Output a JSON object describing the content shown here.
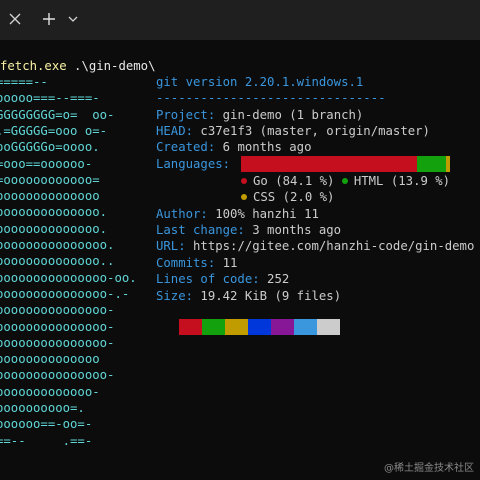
{
  "tabbar": {
    "icons": [
      "close-icon",
      "plus-icon",
      "chevron-down-icon"
    ]
  },
  "command": {
    "exe": "fetch.exe",
    "arg": " .\\gin-demo\\"
  },
  "logo": {
    "lines": [
      "=====--",
      "ooooo===--===-",
      "GGGGGGGG=o=  oo-",
      ".=GGGGG=ooo o=-",
      "ooGGGGGo=oooo.",
      "=ooo==oooooo-",
      "=oooooooooooo=",
      "oooooooooooooo",
      "oooooooooooooo.",
      "oooooooooooooo.",
      "ooooooooooooooo.",
      "oooooooooooooo..",
      "ooooooooooooooo-oo.",
      "ooooooooooooooo-.-",
      "ooooooooooooooo-",
      "ooooooooooooooo-",
      "ooooooooooooooo-",
      "oooooooooooooo",
      "ooooooooooooooo-",
      "ooooooooooooo-",
      "oooooooooo=.",
      "oooooo==-oo=-",
      "==--     .==-"
    ]
  },
  "info": {
    "title": "git version 2.20.1.windows.1",
    "separator": "-------------------------------",
    "project_key": "Project:",
    "project_val": " gin-demo (1 branch)",
    "head_key": "HEAD:",
    "head_val": " c37e1f3 (master, origin/master)",
    "created_key": "Created:",
    "created_val": " 6 months ago",
    "languages_key": "Languages:",
    "author_key": "Author:",
    "author_val": " 100% hanzhi 11",
    "last_change_key": "Last change:",
    "last_change_val": " 3 months ago",
    "url_key": "URL:",
    "url_val": " https://gitee.com/hanzhi-code/gin-demo",
    "commits_key": "Commits:",
    "commits_val": " 11",
    "loc_key": "Lines of code:",
    "loc_val": " 252",
    "size_key": "Size:",
    "size_val": " 19.42 KiB (9 files)"
  },
  "languages": [
    {
      "name": "Go",
      "label": "Go (84.1 %)",
      "percent": 84.1,
      "color": "#c50f1f"
    },
    {
      "name": "HTML",
      "label": "HTML (13.9 %)",
      "percent": 13.9,
      "color": "#13a10e"
    },
    {
      "name": "CSS",
      "label": "CSS (2.0 %)",
      "percent": 2.0,
      "color": "#c19c00"
    }
  ],
  "palette": [
    "#c50f1f",
    "#13a10e",
    "#c19c00",
    "#0037da",
    "#881798",
    "#3a96dd",
    "#cccccc"
  ],
  "watermark": "@稀土掘金技术社区"
}
